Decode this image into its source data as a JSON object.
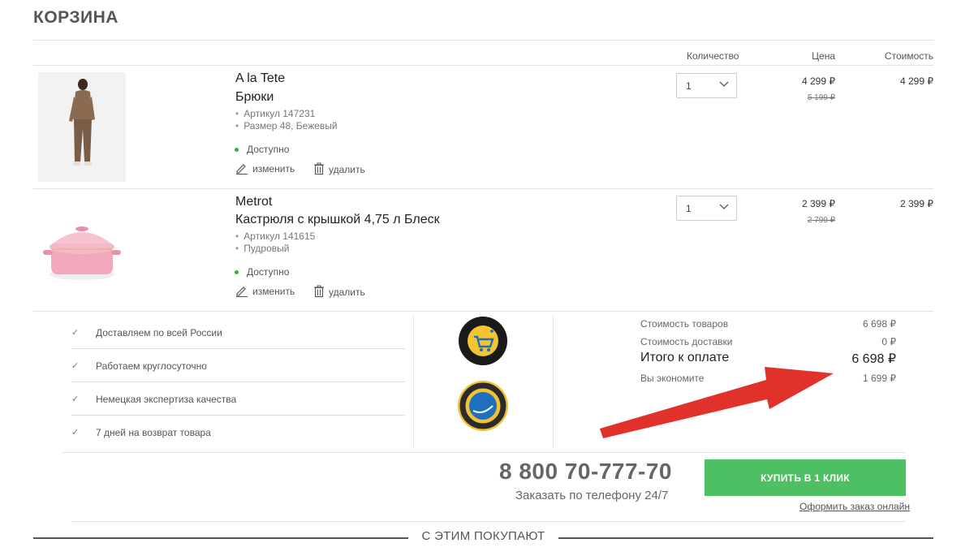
{
  "page": {
    "title": "КОРЗИНА"
  },
  "columns": {
    "quantity": "Количество",
    "price": "Цена",
    "cost": "Стоимость"
  },
  "items": [
    {
      "brand": "A la Tete",
      "name": "Брюки",
      "props": [
        "Артикул 147231",
        "Размер 48, Бежевый"
      ],
      "availability": "Доступно",
      "qty": "1",
      "price": "4 299 ₽",
      "old_price": "5 199 ₽",
      "cost": "4 299 ₽",
      "edit": "изменить",
      "remove": "удалить"
    },
    {
      "brand": "Metrot",
      "name": "Кастрюля с крышкой 4,75 л Блеск",
      "props": [
        "Артикул 141615",
        "Пудровый"
      ],
      "availability": "Доступно",
      "qty": "1",
      "price": "2 399 ₽",
      "old_price": "2 799 ₽",
      "cost": "2 399 ₽",
      "edit": "изменить",
      "remove": "удалить"
    }
  ],
  "features": [
    "Доставляем по всей России",
    "Работаем круглосуточно",
    "Немецкая экспертиза качества",
    "7 дней на возврат товара"
  ],
  "summary": {
    "goods_label": "Стоимость товаров",
    "goods_value": "6 698 ₽",
    "delivery_label": "Стоимость доставки",
    "delivery_value": "0 ₽",
    "total_label": "Итого к оплате",
    "total_value": "6 698 ₽",
    "savings_label": "Вы экономите",
    "savings_value": "1 699 ₽"
  },
  "order": {
    "phone": "8 800 70-777-70",
    "phone_caption": "Заказать по телефону 24/7",
    "buy_button": "КУПИТЬ В 1 КЛИК",
    "online_link": "Оформить заказ онлайн"
  },
  "related": {
    "title": "С ЭТИМ ПОКУПАЮТ"
  },
  "colors": {
    "accent_green": "#4ec063",
    "arrow_red": "#e0322b",
    "available_dot": "#2cb532"
  }
}
